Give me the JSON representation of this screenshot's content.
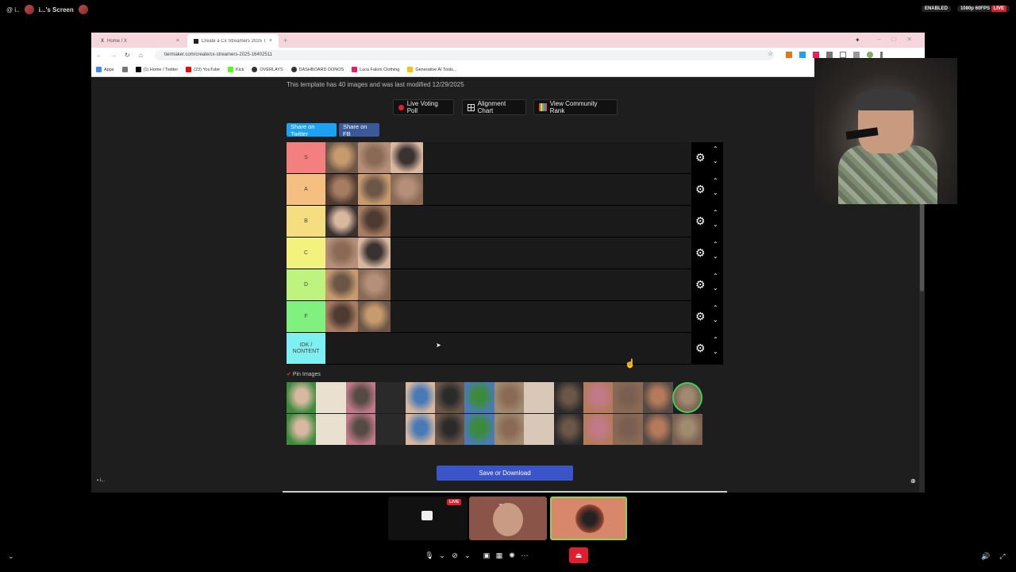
{
  "overlay": {
    "caller_prefix": "@  i..",
    "screen_name": "i...'s Screen",
    "enabled_badge": "ENABLED",
    "quality_badge": "1080p 60FPS",
    "live_badge": "LIVE"
  },
  "browser": {
    "tabs": [
      {
        "label": "Home / X",
        "close": "×"
      },
      {
        "label": "Create a Cx Streamers 2025 Ti...",
        "close": "×"
      }
    ],
    "new_tab": "+",
    "url": "tiermaker.com/create/cx-streamers-2025-16402511",
    "bookmarks": [
      {
        "label": "Apps",
        "color": "#4285f4"
      },
      {
        "label": "(1) Home / Twitter",
        "color": "#000000"
      },
      {
        "label": "(23) YouTube",
        "color": "#ff0000"
      },
      {
        "label": "Kick",
        "color": "#53fc18"
      },
      {
        "label": "OVERLAYS",
        "color": "#333333"
      },
      {
        "label": "DASHBOARD DONOS",
        "color": "#333333"
      },
      {
        "label": "Luca Faloni Clothing",
        "color": "#e91e63"
      },
      {
        "label": "Generative AI Tools...",
        "color": "#ffc107"
      }
    ]
  },
  "tiermaker": {
    "template_info": "This template has 40 images and was last modified 12/29/2025",
    "buttons": {
      "live_voting": "Live Voting Poll",
      "alignment": "Alignment Chart",
      "community_rank": "View Community Rank"
    },
    "share_twitter": "Share on Twitter",
    "share_fb": "Share on FB",
    "tiers": [
      {
        "label": "S",
        "color": "#f37f7f",
        "images": 3
      },
      {
        "label": "A",
        "color": "#f4bf80",
        "images": 3
      },
      {
        "label": "B",
        "color": "#f4de7f",
        "images": 2
      },
      {
        "label": "C",
        "color": "#f3f27e",
        "images": 2
      },
      {
        "label": "D",
        "color": "#bff37f",
        "images": 2
      },
      {
        "label": "F",
        "color": "#80f07e",
        "images": 2
      },
      {
        "label": "IDK / NONTENT",
        "color": "#7ff0f1",
        "images": 0
      }
    ],
    "pin_images": "Pin Images",
    "pool_count": 28,
    "save_button": "Save or Download"
  },
  "meeting": {
    "stage_live": "LIVE"
  }
}
